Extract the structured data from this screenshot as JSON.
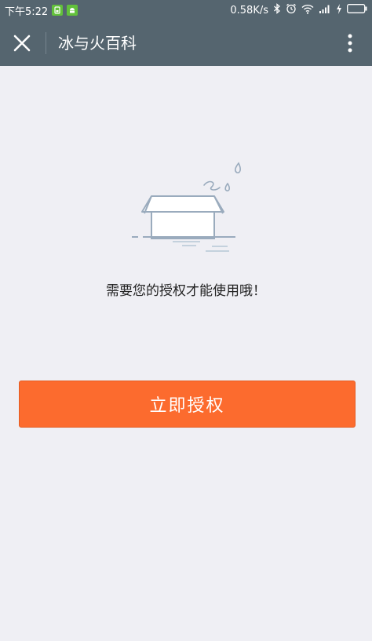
{
  "status_bar": {
    "time": "下午5:22",
    "network_speed": "0.58K/s"
  },
  "title_bar": {
    "title": "冰与火百科"
  },
  "main": {
    "message": "需要您的授权才能使用哦！",
    "authorize_label": "立即授权"
  },
  "colors": {
    "header_bg": "#55656f",
    "page_bg": "#efeff4",
    "button_bg": "#fc6b2e"
  },
  "icons": {
    "close": "close-icon",
    "more": "more-vertical-icon",
    "illustration": "empty-box-icon"
  }
}
